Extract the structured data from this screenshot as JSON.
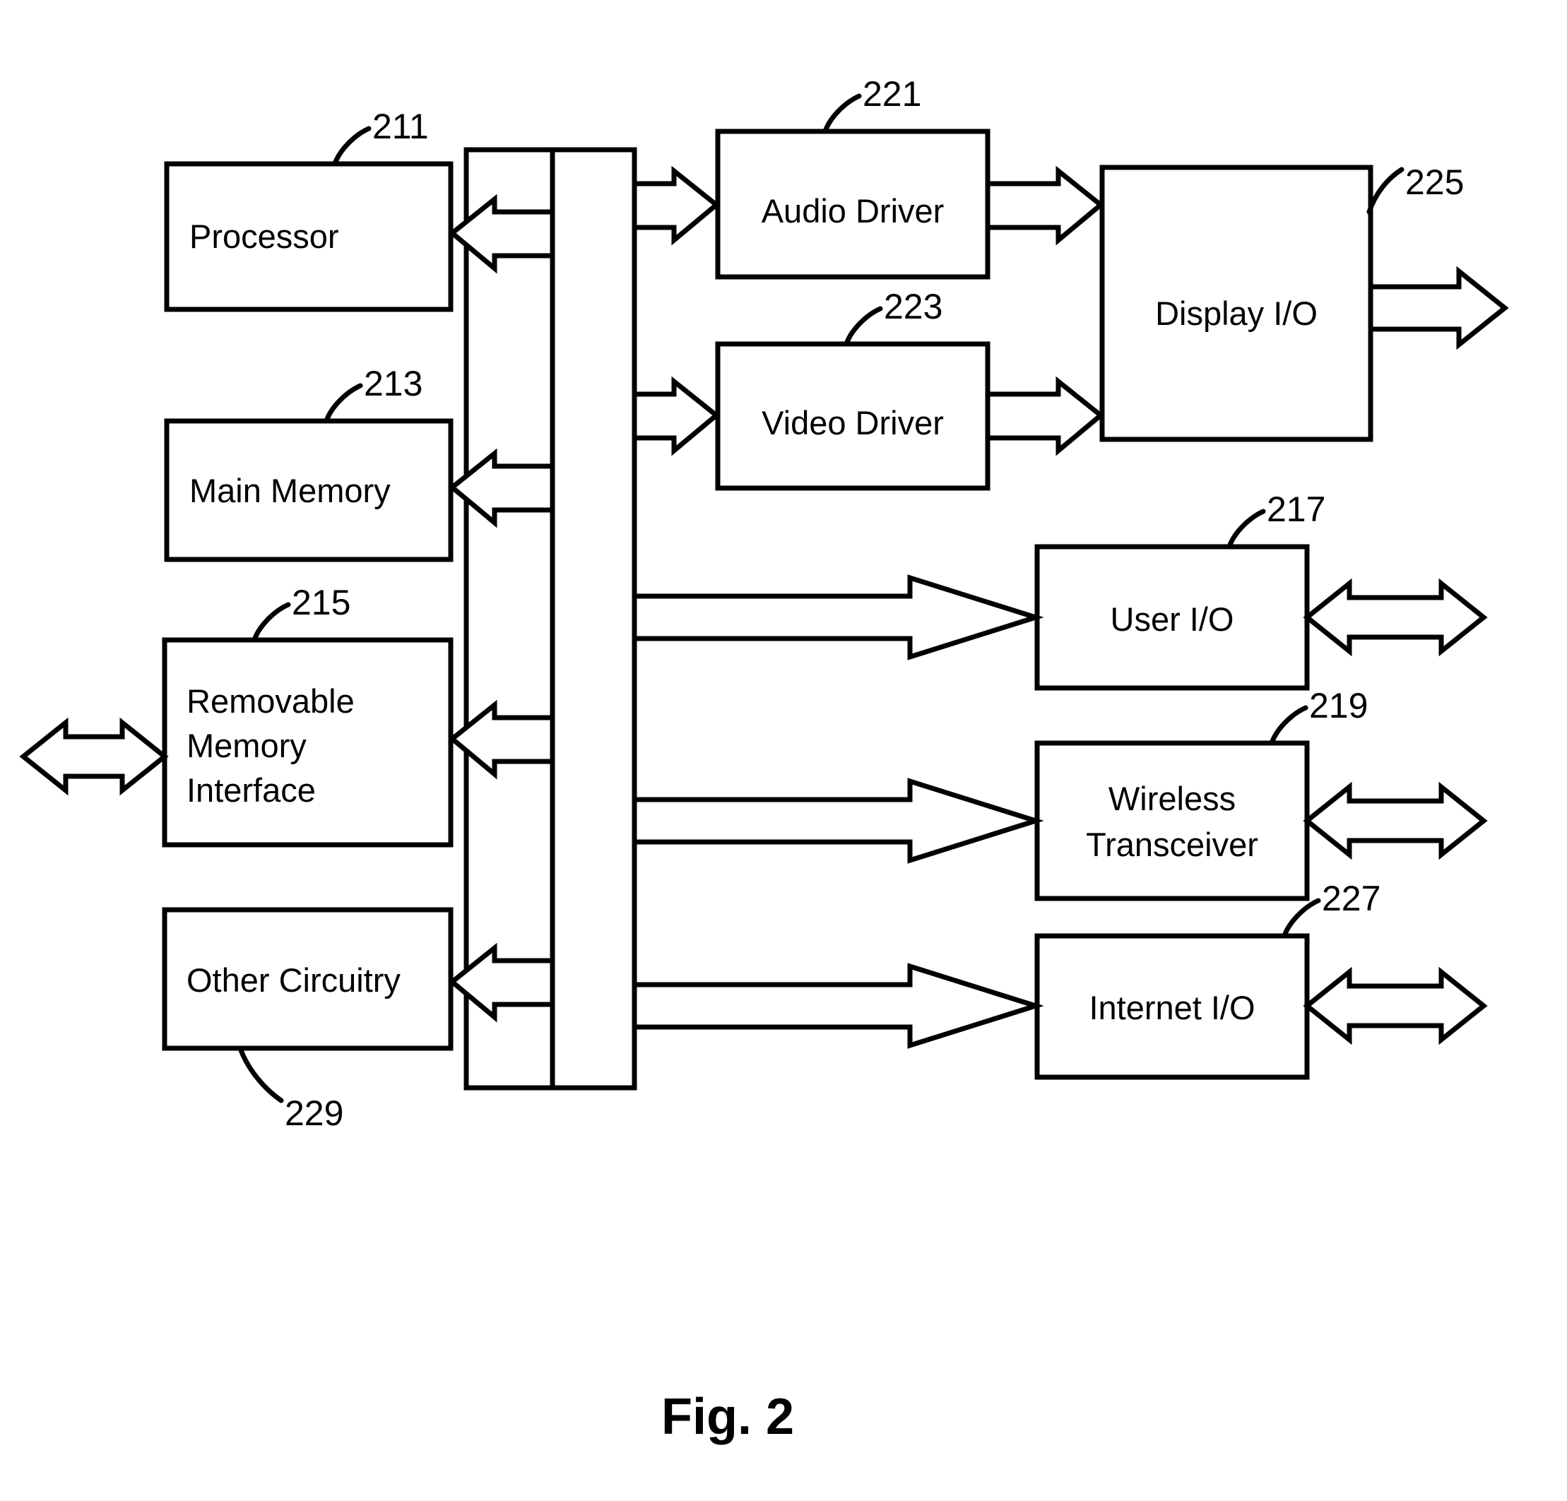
{
  "figure": {
    "caption": "Fig. 2",
    "blocks": [
      {
        "id": "processor",
        "label": "Processor",
        "ref": "211"
      },
      {
        "id": "main-memory",
        "label": "Main Memory",
        "ref": "213"
      },
      {
        "id": "removable-memory",
        "label_line1": "Removable",
        "label_line2": "Memory",
        "label_line3": "Interface",
        "ref": "215"
      },
      {
        "id": "other-circuitry",
        "label": "Other Circuitry",
        "ref": "229"
      },
      {
        "id": "audio-driver",
        "label": "Audio Driver",
        "ref": "221"
      },
      {
        "id": "video-driver",
        "label": "Video Driver",
        "ref": "223"
      },
      {
        "id": "display-io",
        "label": "Display I/O",
        "ref": "225"
      },
      {
        "id": "user-io",
        "label": "User I/O",
        "ref": "217"
      },
      {
        "id": "wireless",
        "label_line1": "Wireless",
        "label_line2": "Transceiver",
        "ref": "219"
      },
      {
        "id": "internet-io",
        "label": "Internet I/O",
        "ref": "227"
      }
    ],
    "colors": {
      "line": "#000000",
      "fill": "#ffffff",
      "background": "#ffffff"
    }
  }
}
